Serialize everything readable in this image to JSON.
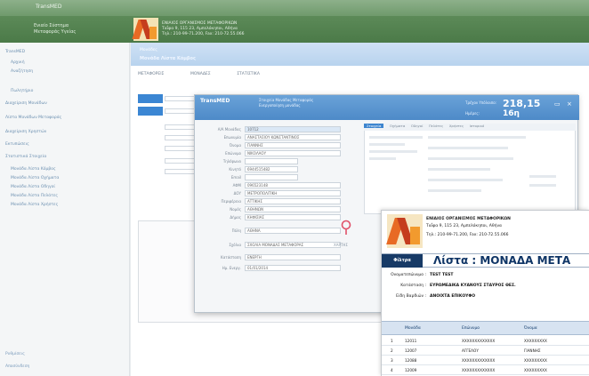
{
  "app": {
    "window_title": "TransMED",
    "brand_lines": [
      "Ενιαίο Σύστημα",
      "Μεταφοράς Υγείας"
    ],
    "org_name": "ΕΝΙΑΙΟΣ ΟΡΓΑΝΙΣΜΟΣ ΜΕΤΑΦΟΡΙΚΩΝ",
    "org_lines": [
      "Ταΐφα 9, 115 23, Αμπελόκηποι, Αθήνα",
      "Τηλ.: 210-99-71.200, Fax: 210-72.55.066"
    ]
  },
  "sidebar": {
    "items": [
      {
        "label": "TransMED"
      },
      {
        "label": "Αρχική"
      },
      {
        "label": "Αναζήτηση"
      },
      {
        "label": "Πωλητήριο"
      },
      {
        "label": "Διαχείριση Μονάδων"
      },
      {
        "label": "Λίστα Μονάδων Μεταφοράς"
      },
      {
        "label": "Διαχείριση Χρηστών"
      },
      {
        "label": "Εκτυπώσεις"
      },
      {
        "label": "Στατιστικά Στοιχεία"
      },
      {
        "label": "Μονάδα Λίστα Κόμβος"
      },
      {
        "label": "Μονάδα Λίστα Οχήματα"
      },
      {
        "label": "Μονάδα Λίστα Οδηγοί"
      },
      {
        "label": "Μονάδα Λίστα Πελάτες"
      },
      {
        "label": "Μονάδα Λίστα Χρήστες"
      }
    ],
    "bottom": [
      "Ρυθμίσεις",
      "Αποσύνδεση"
    ]
  },
  "crumb": {
    "line1": "Μονάδες",
    "line2": "Μονάδα Λίστα Κόμβος"
  },
  "tabs": [
    "ΜΕΤΑΦΟΡΕΙΣ",
    "ΜΟΝΑΔΕΣ",
    "ΣΤΑΤΙΣΤΙΚΑ"
  ],
  "dialog": {
    "name": "TransMED",
    "info": [
      "Στοιχεία Μονάδας Μεταφοράς",
      "Ενεργοποίηση μονάδας"
    ],
    "amount_label": "Τρέχον Υπόλοιπο:",
    "amount": "218,15",
    "sub_label": "Ημέρες:",
    "sub": "16η",
    "fields": [
      {
        "label": "Α/Α Μονάδας",
        "value": "10712"
      },
      {
        "label": "Επωνυμία",
        "value": "ΑΝΑΣΤΑΣΙΟΥ ΚΩΝΣΤΑΝΤΙΝΟΣ"
      },
      {
        "label": "Όνομα",
        "value": "ΓΙΑΝΝΗΣ"
      },
      {
        "label": "Επώνυμο",
        "value": "ΝΙΚΟΛΑΟΥ"
      },
      {
        "label": "Τηλέφωνο",
        "value": ""
      },
      {
        "label": "Κινητό",
        "value": "6944515482"
      },
      {
        "label": "Email",
        "value": ""
      },
      {
        "label": "ΑΦΜ",
        "value": "096523148"
      },
      {
        "label": "ΔΟΥ",
        "value": "ΜΕΤΡΟΠΟΛΙΤΙΚΗ"
      },
      {
        "label": "Περιφέρεια",
        "value": "ΑΤΤΙΚΗΣ"
      },
      {
        "label": "Νομός",
        "value": "ΑΘΗΝΩΝ"
      },
      {
        "label": "Δήμος",
        "value": "ΚΗΦΙΣΙΑΣ"
      },
      {
        "label": "Πόλη",
        "value": "ΑΘΗΝΑ"
      },
      {
        "label": "Σχόλια",
        "value": "ΣΧΟΛΙΑ ΜΟΝΑΔΑΣ ΜΕΤΑΦΟΡΑΣ"
      },
      {
        "label": "Κατάσταση",
        "value": "ΕΝΕΡΓΗ"
      },
      {
        "label": "Ημ. Ενεργ.",
        "value": "01/01/2014"
      }
    ],
    "right_tabs": [
      "Στοιχεία",
      "Οχήματα",
      "Οδηγοί",
      "Πελάτες",
      "Χρήστες",
      "Ιστορικό"
    ],
    "pin_label": "ΧΑΡΤΗΣ"
  },
  "doc": {
    "org1": "ΕΝΙΑΙΟΣ ΟΡΓΑΝΙΣΜΟΣ ΜΕΤΑΦΟΡΙΚΩΝ",
    "org2": "Ταΐφα 9, 115 23, Αμπελόκηποι, Αθήνα",
    "org3": "Τηλ.: 210-99-71.200, Fax: 210-72.55.066",
    "tag": "Φίλτρα",
    "title": "Λίστα : ΜΟΝΑΔΑ ΜΕΤΑ",
    "meta": [
      {
        "k": "Ονοματεπώνυμο :",
        "v": "TEST TEST"
      },
      {
        "k": "Κατάσταση :",
        "v": "ΕΥΡΩΜΕΔΙΚΑ ΚΥΑΝΟΥΣ ΣΤΑΥΡΟΣ ΘΕΣ."
      },
      {
        "k": "Είδη Βαρδιών :",
        "v": "ΑΝΟΙΧΤΑ ΕΠΙΚΟΥΦΟ"
      }
    ],
    "columns": [
      "Μονάδα",
      "Επώνυμο",
      "Όνομα"
    ],
    "rows": [
      {
        "n": "1",
        "id": "12011",
        "a": "ΧΧΧΧΧΧΧΧΧΧΧΧΧ",
        "b": "ΧΧΧΧΧΧΧΧΧ"
      },
      {
        "n": "2",
        "id": "12007",
        "a": "ΑΓΓΕΛΟΥ",
        "b": "ΓΙΑΝΝΗΣ"
      },
      {
        "n": "3",
        "id": "12088",
        "a": "ΧΧΧΧΧΧΧΧΧΧΧΧΧ",
        "b": "ΧΧΧΧΧΧΧΧΧ"
      },
      {
        "n": "4",
        "id": "12009",
        "a": "ΧΧΧΧΧΧΧΧΧΧΧΧΧ",
        "b": "ΧΧΧΧΧΧΧΧΧ"
      }
    ]
  }
}
